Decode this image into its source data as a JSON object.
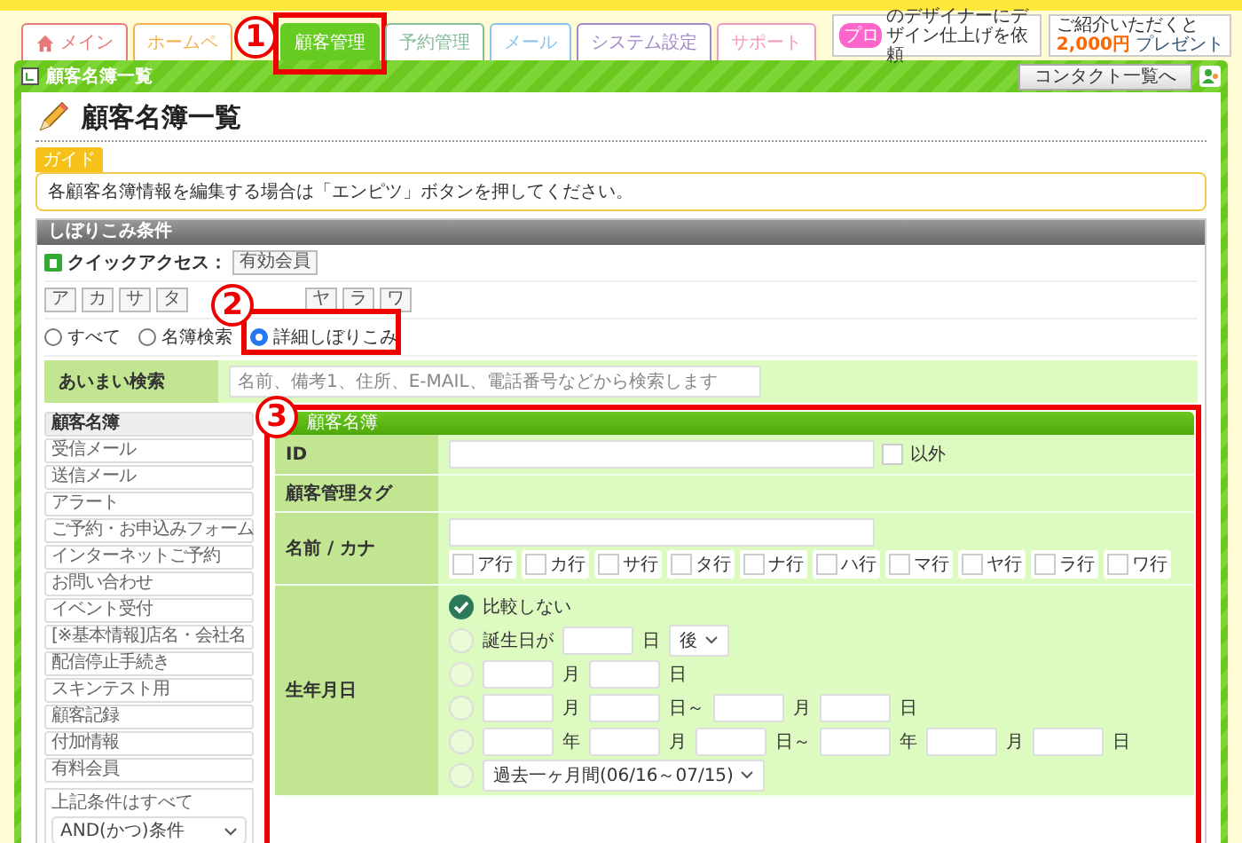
{
  "tabs": [
    {
      "label": "メイン",
      "selected": false,
      "color": "#e87878"
    },
    {
      "label": "ホームペ",
      "selected": false,
      "color": "#f5b050"
    },
    {
      "label": "顧客管理",
      "selected": true,
      "color": "#66cc22"
    },
    {
      "label": "予約管理",
      "selected": false,
      "color": "#88bb99"
    },
    {
      "label": "メール",
      "selected": false,
      "color": "#88c4ee"
    },
    {
      "label": "システム設定",
      "selected": false,
      "color": "#a088c8"
    },
    {
      "label": "サポート",
      "selected": false,
      "color": "#f09ac0"
    }
  ],
  "banners": {
    "designer": {
      "badge": "プロ",
      "text": "のデザイナーにデザイン仕上げを依頼"
    },
    "referral": {
      "caption": "ご紹介いただくと",
      "amount": "2,000円",
      "note": "プレゼント"
    }
  },
  "frame": {
    "title": "顧客名簿一覧",
    "contact_button": "コンタクト一覧へ"
  },
  "page_title": "顧客名簿一覧",
  "guide": {
    "tag": "ガイド",
    "text": "各顧客名簿情報を編集する場合は「エンピツ」ボタンを押してください。"
  },
  "filter": {
    "title": "しぼりこみ条件",
    "quick_access_label": "クイックアクセス：",
    "quick_buttons": [
      "有効会員"
    ],
    "kana_before": [
      "ア",
      "カ",
      "サ",
      "タ"
    ],
    "kana_after": [
      "ヤ",
      "ラ",
      "ワ"
    ],
    "modes": [
      {
        "label": "すべて",
        "selected": false
      },
      {
        "label": "名簿検索",
        "selected": false
      },
      {
        "label": "詳細しぼりこみ",
        "selected": true
      }
    ],
    "fuzzy": {
      "label": "あいまい検索",
      "placeholder": "名前、備考1、住所、E-MAIL、電話番号などから検索します"
    }
  },
  "sidebar": {
    "items": [
      {
        "label": "顧客名簿",
        "selected": true
      },
      {
        "label": "受信メール",
        "selected": false
      },
      {
        "label": "送信メール",
        "selected": false
      },
      {
        "label": "アラート",
        "selected": false
      },
      {
        "label": "ご予約・お申込みフォーム",
        "selected": false
      },
      {
        "label": "インターネットご予約",
        "selected": false
      },
      {
        "label": "お問い合わせ",
        "selected": false
      },
      {
        "label": "イベント受付",
        "selected": false
      },
      {
        "label": "[※基本情報]店名・会社名",
        "selected": false
      },
      {
        "label": "配信停止手続き",
        "selected": false
      },
      {
        "label": "スキンテスト用",
        "selected": false
      },
      {
        "label": "顧客記録",
        "selected": false
      },
      {
        "label": "付加情報",
        "selected": false
      },
      {
        "label": "有料会員",
        "selected": false
      }
    ],
    "combine_label": "上記条件はすべて",
    "combine_value": "AND(かつ)条件"
  },
  "table": {
    "title": "顧客名簿",
    "id": {
      "label": "ID",
      "exclude": {
        "label": "以外",
        "checked": false
      }
    },
    "tag": {
      "label": "顧客管理タグ"
    },
    "name": {
      "label": "名前 / カナ",
      "rows": [
        {
          "label": "ア行",
          "checked": false
        },
        {
          "label": "カ行",
          "checked": false
        },
        {
          "label": "サ行",
          "checked": false
        },
        {
          "label": "タ行",
          "checked": false
        },
        {
          "label": "ナ行",
          "checked": false
        },
        {
          "label": "ハ行",
          "checked": false
        },
        {
          "label": "マ行",
          "checked": false
        },
        {
          "label": "ヤ行",
          "checked": false
        },
        {
          "label": "ラ行",
          "checked": false
        },
        {
          "label": "ワ行",
          "checked": false
        }
      ]
    },
    "birth": {
      "label": "生年月日",
      "options": [
        {
          "selected": true,
          "parts": [
            {
              "kind": "text",
              "text": "比較しない"
            }
          ]
        },
        {
          "selected": false,
          "parts": [
            {
              "kind": "text",
              "text": "誕生日が"
            },
            {
              "kind": "input"
            },
            {
              "kind": "text",
              "text": "日"
            },
            {
              "kind": "select",
              "text": "後"
            }
          ]
        },
        {
          "selected": false,
          "parts": [
            {
              "kind": "input"
            },
            {
              "kind": "text",
              "text": "月"
            },
            {
              "kind": "input"
            },
            {
              "kind": "text",
              "text": "日"
            }
          ]
        },
        {
          "selected": false,
          "parts": [
            {
              "kind": "input"
            },
            {
              "kind": "text",
              "text": "月"
            },
            {
              "kind": "input"
            },
            {
              "kind": "text",
              "text": "日～"
            },
            {
              "kind": "input"
            },
            {
              "kind": "text",
              "text": "月"
            },
            {
              "kind": "input"
            },
            {
              "kind": "text",
              "text": "日"
            }
          ]
        },
        {
          "selected": false,
          "parts": [
            {
              "kind": "input"
            },
            {
              "kind": "text",
              "text": "年"
            },
            {
              "kind": "input"
            },
            {
              "kind": "text",
              "text": "月"
            },
            {
              "kind": "input"
            },
            {
              "kind": "text",
              "text": "日～"
            },
            {
              "kind": "input"
            },
            {
              "kind": "text",
              "text": "年"
            },
            {
              "kind": "input"
            },
            {
              "kind": "text",
              "text": "月"
            },
            {
              "kind": "input"
            },
            {
              "kind": "text",
              "text": "日"
            }
          ]
        },
        {
          "selected": false,
          "parts": [
            {
              "kind": "select",
              "text": "過去一ヶ月間(06/16～07/15)"
            }
          ]
        }
      ]
    }
  },
  "callouts": [
    "1",
    "2",
    "3"
  ]
}
